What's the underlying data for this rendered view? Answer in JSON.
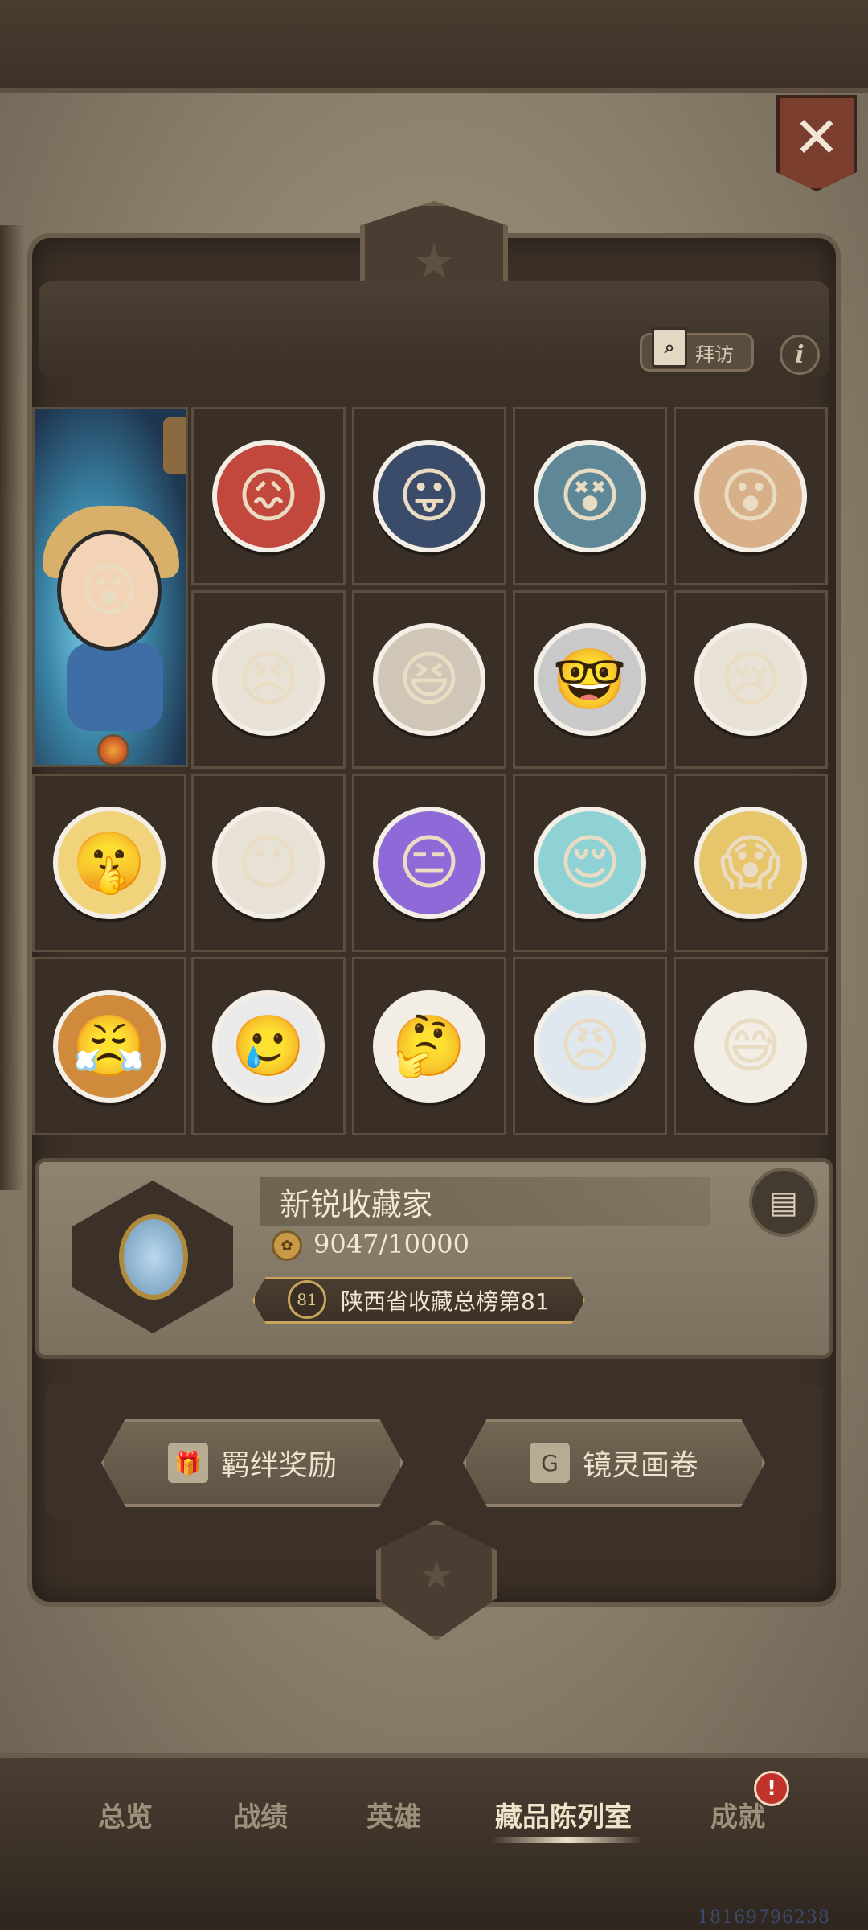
{
  "header": {
    "close_label": "✕"
  },
  "toolbar": {
    "visit_label": "拜访",
    "visit_icon": "map-search-icon",
    "info_label": "i"
  },
  "featured": {
    "name": "featured-hero-portrait"
  },
  "stickers": [
    {
      "emoji": "😖",
      "bg": "#c2473c"
    },
    {
      "emoji": "😛",
      "bg": "#3b4c6b"
    },
    {
      "emoji": "😵",
      "bg": "#5e8798"
    },
    {
      "emoji": "😮",
      "bg": "#d7b08a"
    },
    {
      "emoji": "😣",
      "bg": "#e8e2d6"
    },
    {
      "emoji": "😆",
      "bg": "#cfc6b8"
    },
    {
      "emoji": "🤓",
      "bg": "#c9c9c9"
    },
    {
      "emoji": "😢",
      "bg": "#e8e2d6"
    },
    {
      "emoji": "🤫",
      "bg": "#f0d37a"
    },
    {
      "emoji": "😶",
      "bg": "#e8e2d6"
    },
    {
      "emoji": "😑",
      "bg": "#8d6ad8"
    },
    {
      "emoji": "😌",
      "bg": "#8ed2d6"
    },
    {
      "emoji": "😱",
      "bg": "#e7c56b"
    },
    {
      "emoji": "😤",
      "bg": "#d08a3b"
    },
    {
      "emoji": "🥲",
      "bg": "#eaeaea"
    },
    {
      "emoji": "🤔",
      "bg": "#f2eee6"
    },
    {
      "emoji": "😠",
      "bg": "#dfe8ef"
    },
    {
      "emoji": "😅",
      "bg": "#f2eee6"
    }
  ],
  "profile": {
    "title": "新锐收藏家",
    "coin_icon": "coin-icon",
    "progress": "9047/10000",
    "rank_number": "81",
    "rank_text": "陕西省收藏总榜第81",
    "scroll_icon": "scroll-icon"
  },
  "actions": {
    "bond_reward": "羁绊奖励",
    "mirror_scroll": "镜灵画卷"
  },
  "nav": {
    "items": [
      "总览",
      "战绩",
      "英雄",
      "藏品陈列室",
      "成就"
    ],
    "active": "藏品陈列室",
    "badge": "!"
  },
  "watermark": "18169796238",
  "colors": {
    "frame": "#3c3128",
    "accent_gold": "#c9a55c",
    "badge_red": "#c0322a"
  }
}
